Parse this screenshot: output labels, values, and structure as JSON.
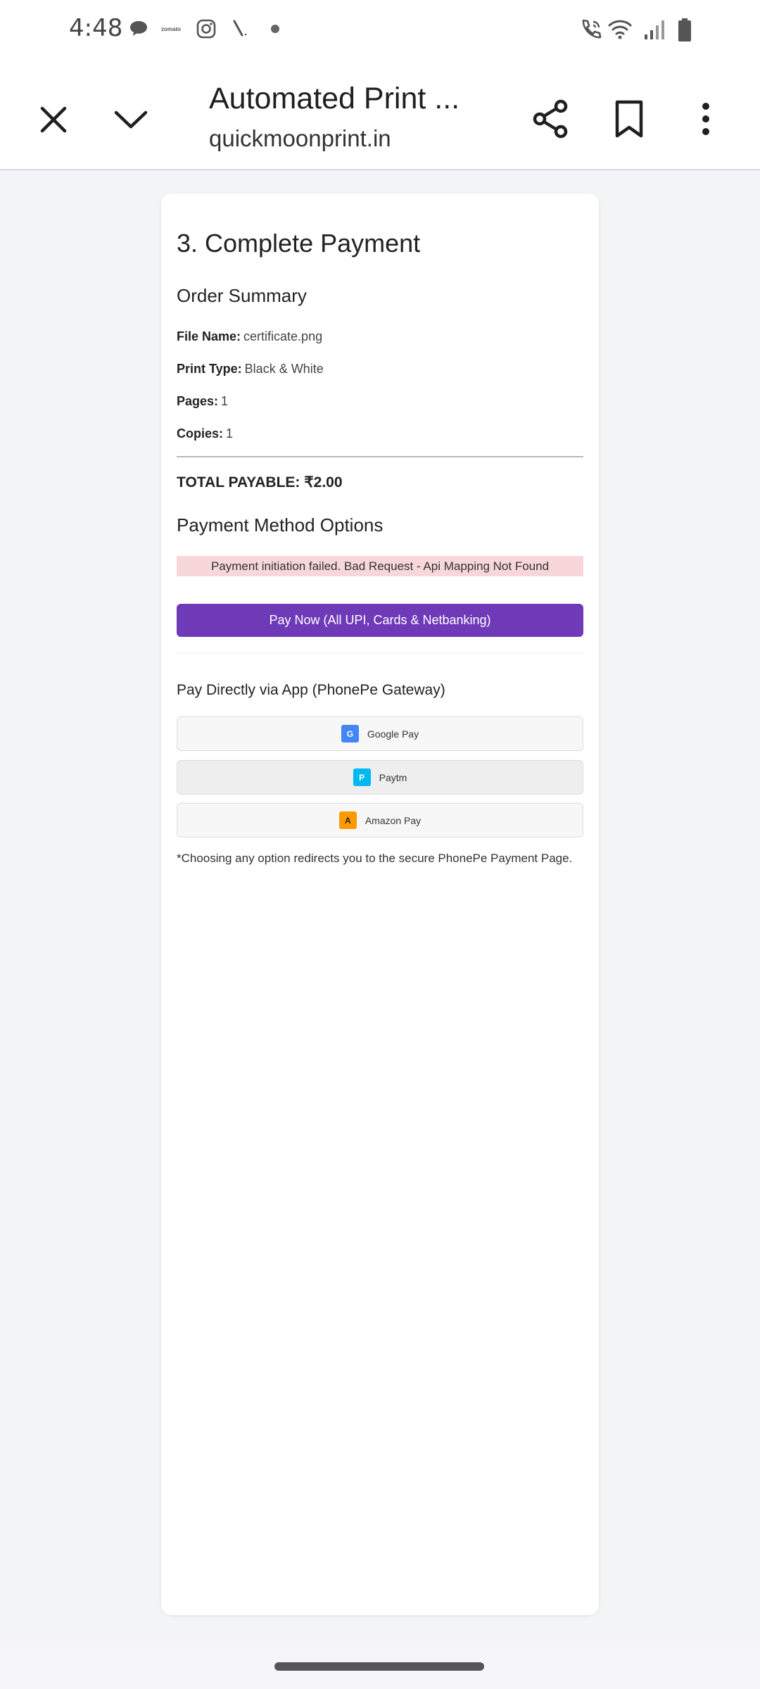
{
  "status_bar": {
    "time": "4:48",
    "left_icons": [
      "chat-bubble-icon",
      "zomato-icon",
      "instagram-icon",
      "pen-icon",
      "dot-icon"
    ],
    "zomato_text": "zomato",
    "right_icons": [
      "wifi-calling-icon",
      "wifi-icon",
      "signal-icon",
      "battery-icon"
    ]
  },
  "browser": {
    "title": "Automated Print ...",
    "url": "quickmoonprint.in",
    "buttons": [
      "close-icon",
      "chevron-down-icon",
      "share-icon",
      "bookmark-icon",
      "more-vert-icon"
    ]
  },
  "page": {
    "step_heading": "3. Complete Payment",
    "summary_heading": "Order Summary",
    "summary_rows": [
      {
        "label": "File Name:",
        "value": "certificate.png"
      },
      {
        "label": "Print Type:",
        "value": "Black & White"
      },
      {
        "label": "Pages:",
        "value": "1"
      },
      {
        "label": "Copies:",
        "value": "1"
      }
    ],
    "total_label": "TOTAL PAYABLE:",
    "total_value": "₹2.00",
    "method_heading": "Payment Method Options",
    "error_message": "Payment initiation failed. Bad Request - Api Mapping Not Found",
    "pay_now_label": "Pay Now (All UPI, Cards & Netbanking)",
    "direct_heading": "Pay Directly via App (PhonePe Gateway)",
    "apps": [
      {
        "letter": "G",
        "label": "Google Pay",
        "color": "#4285f4"
      },
      {
        "letter": "P",
        "label": "Paytm",
        "color": "#00b9f1"
      },
      {
        "letter": "A",
        "label": "Amazon Pay",
        "color": "#ff9900"
      }
    ],
    "note": "*Choosing any option redirects you to the secure PhonePe Payment Page."
  },
  "colors": {
    "accent": "#6f3ab8",
    "error_bg": "#f8d7da"
  }
}
